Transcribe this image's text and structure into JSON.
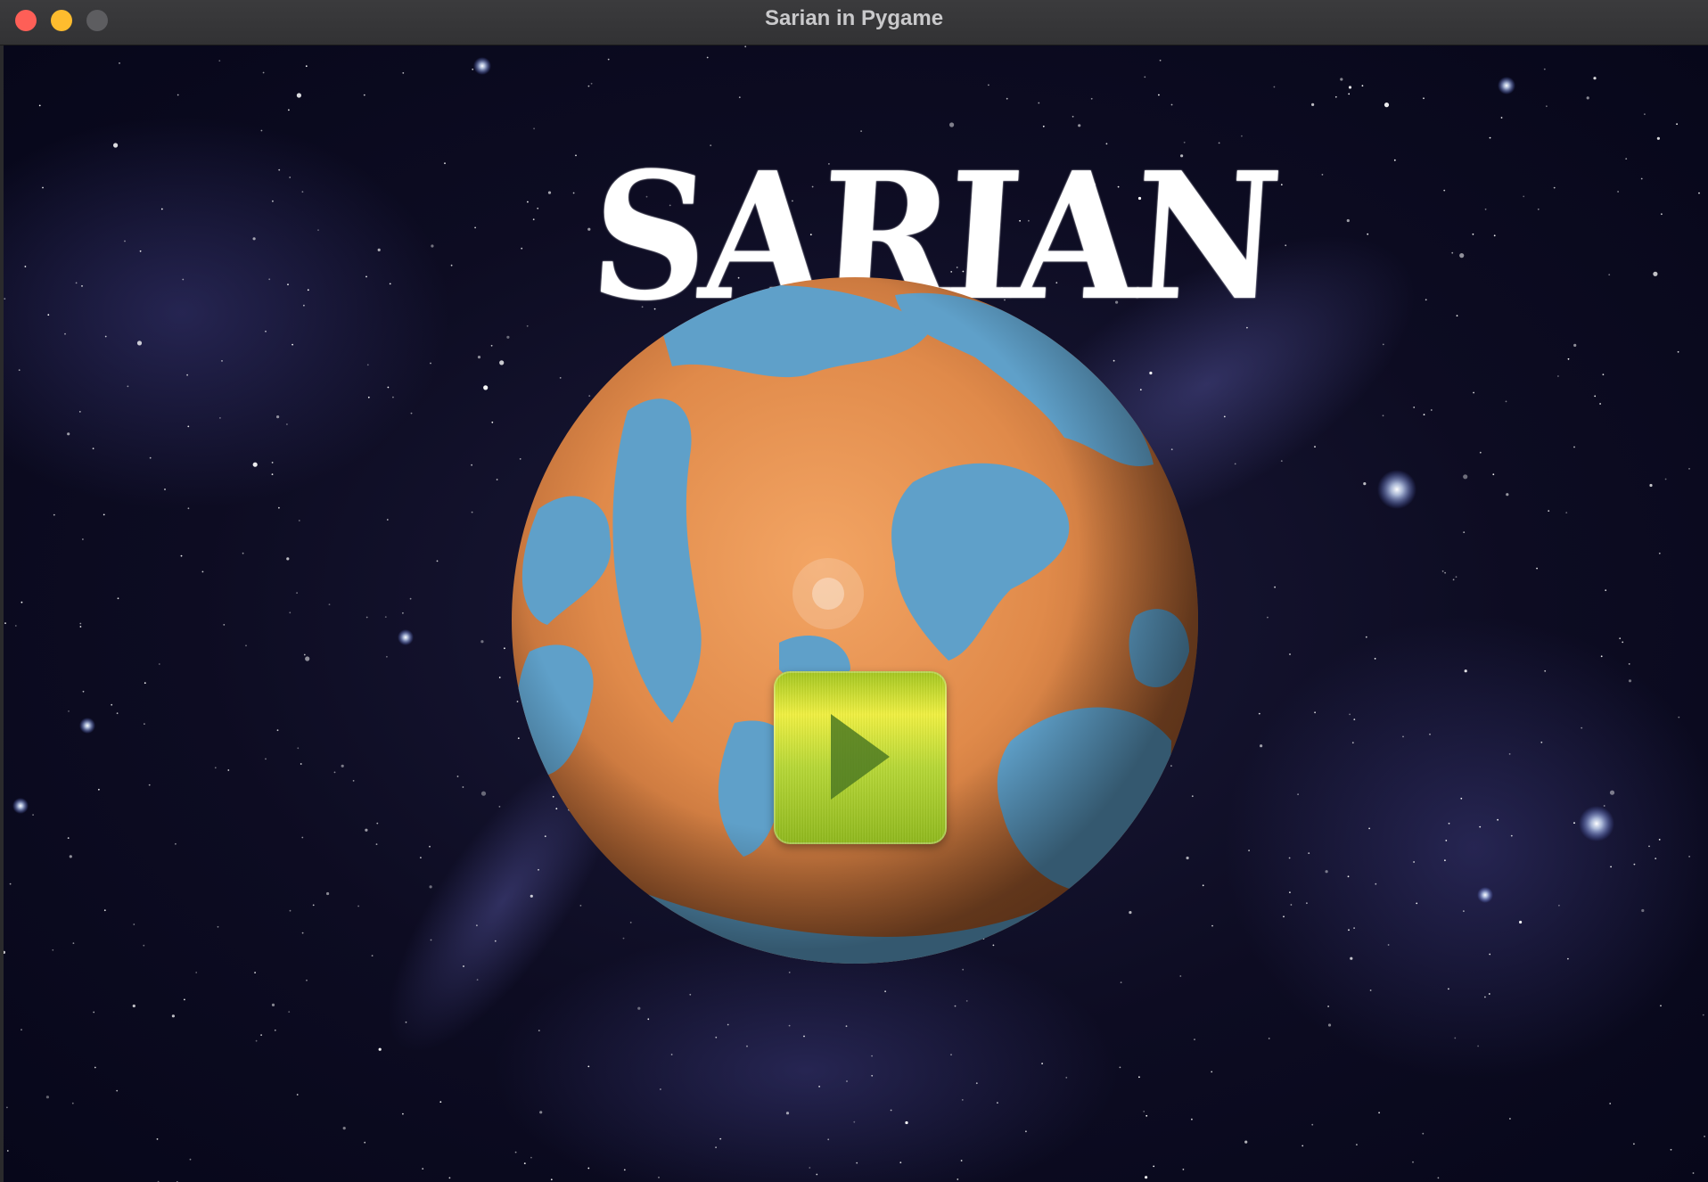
{
  "window": {
    "title": "Sarian in Pygame"
  },
  "game": {
    "logo_text": "SARIAN",
    "play_button": {
      "icon": "play-icon",
      "color": "#b7d836"
    }
  },
  "colors": {
    "space": "#0d0c22",
    "planet_land": "#e08a4a",
    "planet_water": "#5fa0c9",
    "close": "#fe5f57",
    "minimize": "#febc2e",
    "maximize": "#5d5d60"
  }
}
